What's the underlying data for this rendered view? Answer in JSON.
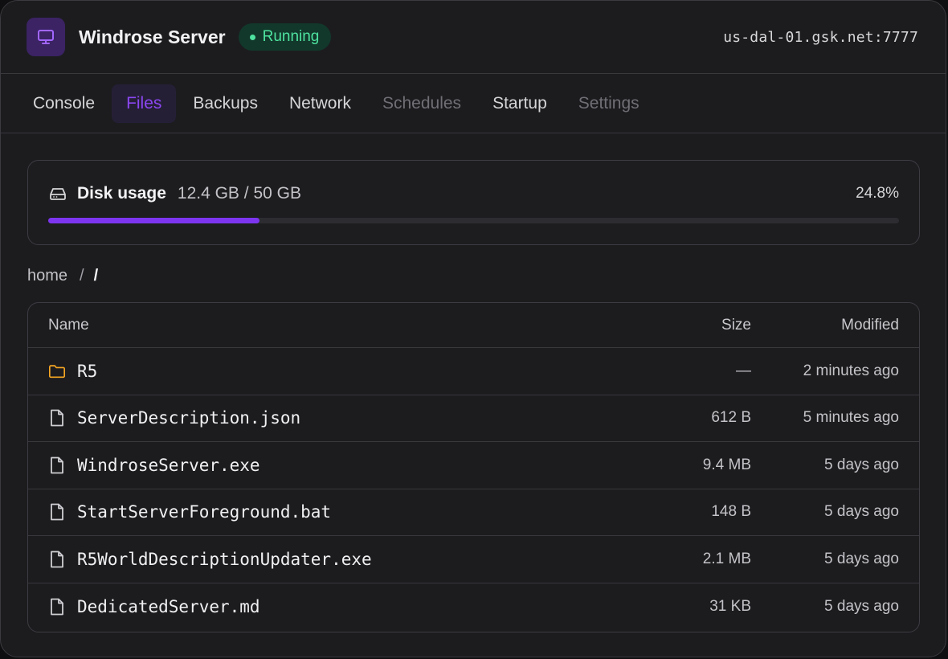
{
  "header": {
    "icon": "monitor-icon",
    "title": "Windrose Server",
    "status": "Running",
    "status_color": "#4ee3a0",
    "host": "us-dal-01.gsk.net:7777"
  },
  "tabs": [
    {
      "label": "Console",
      "state": "normal"
    },
    {
      "label": "Files",
      "state": "active"
    },
    {
      "label": "Backups",
      "state": "normal"
    },
    {
      "label": "Network",
      "state": "normal"
    },
    {
      "label": "Schedules",
      "state": "disabled"
    },
    {
      "label": "Startup",
      "state": "normal"
    },
    {
      "label": "Settings",
      "state": "disabled"
    }
  ],
  "disk": {
    "icon": "hard-drive-icon",
    "label": "Disk usage",
    "amount": "12.4 GB / 50 GB",
    "percent_text": "24.8%",
    "percent": 24.8,
    "accent": "#7d35f0"
  },
  "breadcrumb": {
    "root": "home",
    "separator": "/",
    "current": "/"
  },
  "files": {
    "columns": {
      "name": "Name",
      "size": "Size",
      "modified": "Modified"
    },
    "rows": [
      {
        "icon": "folder-icon",
        "name": "R5",
        "size": "—",
        "modified": "2 minutes ago"
      },
      {
        "icon": "file-icon",
        "name": "ServerDescription.json",
        "size": "612 B",
        "modified": "5 minutes ago"
      },
      {
        "icon": "file-icon",
        "name": "WindroseServer.exe",
        "size": "9.4 MB",
        "modified": "5 days ago"
      },
      {
        "icon": "file-icon",
        "name": "StartServerForeground.bat",
        "size": "148 B",
        "modified": "5 days ago"
      },
      {
        "icon": "file-icon",
        "name": "R5WorldDescriptionUpdater.exe",
        "size": "2.1 MB",
        "modified": "5 days ago"
      },
      {
        "icon": "file-icon",
        "name": "DedicatedServer.md",
        "size": "31 KB",
        "modified": "5 days ago"
      }
    ]
  }
}
